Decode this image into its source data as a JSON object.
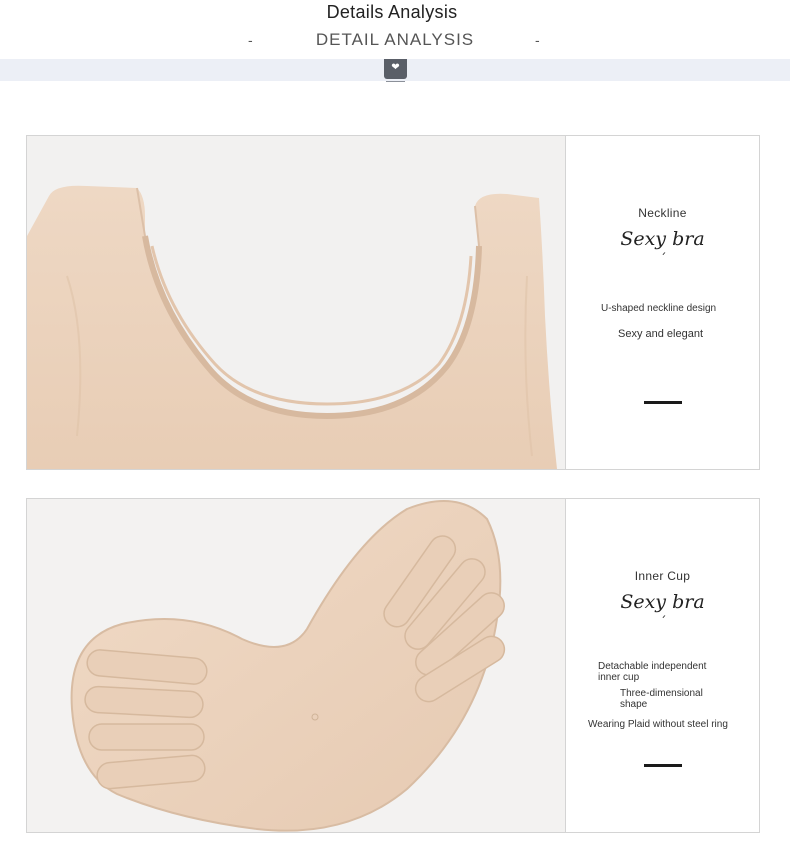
{
  "header": {
    "title": "Details Analysis",
    "subtitle": "DETAIL ANALYSIS",
    "dash_left": "-",
    "dash_right": "-",
    "tab_icon": "heart-icon"
  },
  "sections": [
    {
      "label": "Neckline",
      "script_title": "Sexy bra",
      "tick": "´",
      "descriptions": [
        "U-shaped neckline design",
        "Sexy and elegant"
      ]
    },
    {
      "label": "Inner Cup",
      "script_title": "Sexy bra",
      "tick": "´",
      "descriptions": [
        "Detachable independent inner cup",
        "Three-dimensional shape",
        "Wearing Plaid without steel ring"
      ]
    }
  ],
  "colors": {
    "band": "#eceff6",
    "fabric": "#ecd3bd",
    "accent_bar": "#1a1a1a"
  }
}
